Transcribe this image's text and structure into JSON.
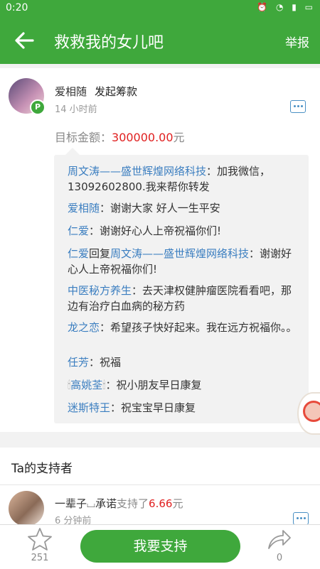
{
  "status_bar": {
    "time": "0:20",
    "icons": [
      "alarm-icon",
      "wifi-icon",
      "signal-icon",
      "battery-icon"
    ]
  },
  "appbar": {
    "title": "救救我的女儿吧",
    "report_label": "举报"
  },
  "post": {
    "username": "爱相随",
    "action": "发起筹款",
    "time_ago": "14 小时前",
    "target_label": "目标金额：",
    "target_amount": "300000.00",
    "target_unit": "元"
  },
  "comments": [
    {
      "name": "周文涛——盛世辉煌网络科技",
      "text": "：加我微信，13092602800.我来帮你转发"
    },
    {
      "name": "爱相随",
      "text": "：谢谢大家 好人一生平安"
    },
    {
      "name": "仁爱",
      "text": "：谢谢好心人上帝祝福你们!"
    },
    {
      "name": "仁爱",
      "reply_word": "回复",
      "reply_to": "周文涛——盛世辉煌网络科技",
      "text": "：谢谢好心人上帝祝福你们!"
    },
    {
      "name": "中医秘方养生",
      "text": "：去天津权健肿瘤医院看看吧，那边有治疗白血病的秘方药"
    },
    {
      "name": "龙之恋",
      "text": "：希望孩子快好起来。我在远方祝福你。。"
    },
    {
      "name": "任芳",
      "text": "：祝福"
    },
    {
      "name": "高姚荃",
      "text": "：祝小朋友早日康复"
    },
    {
      "name": "迷斯特王",
      "text": "：祝宝宝早日康复"
    }
  ],
  "supporters": {
    "header": "Ta的支持者",
    "items": [
      {
        "name": "一辈子⌴承诺",
        "action": "支持了",
        "amount": "6.66",
        "unit": "元",
        "time": "6 分钟前"
      }
    ]
  },
  "bottom": {
    "star_count": "251",
    "support_label": "我要支持",
    "share_count": "0"
  },
  "colors": {
    "brand": "#3fa83c",
    "link": "#3b7ec0",
    "amount": "#e02020"
  }
}
